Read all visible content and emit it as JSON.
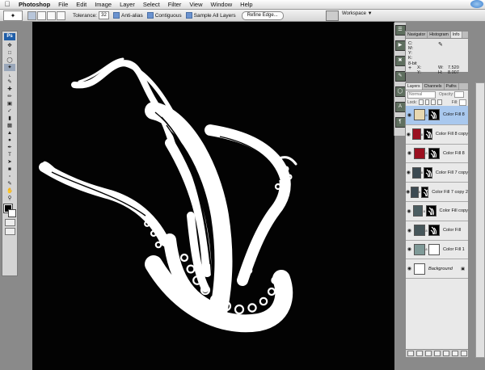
{
  "menu": {
    "app": "Photoshop",
    "items": [
      "File",
      "Edit",
      "Image",
      "Layer",
      "Select",
      "Filter",
      "View",
      "Window",
      "Help"
    ]
  },
  "options": {
    "tolerance_label": "Tolerance:",
    "tolerance_value": "32",
    "anti_alias": "Anti-alias",
    "contiguous": "Contiguous",
    "sample_all": "Sample All Layers",
    "refine": "Refine Edge...",
    "workspace": "Workspace"
  },
  "toolbox": {
    "logo": "Ps"
  },
  "navigator": {
    "tabs": [
      "Navigator",
      "Histogram",
      "Info"
    ],
    "c_label": "C:",
    "m_label": "M:",
    "y_label": "Y:",
    "k_label": "K:",
    "bit_label": "8-bit",
    "x_label": "X:",
    "x_value": "7.520",
    "y2_label": "Y:",
    "y2_value": "8.007",
    "w_label": "W:",
    "h_label": "H:"
  },
  "layers": {
    "tabs": [
      "Layers",
      "Channels",
      "Paths"
    ],
    "blend_mode": "Normal",
    "opacity_label": "Opacity:",
    "lock_label": "Lock:",
    "fill_label": "Fill:",
    "rows": [
      {
        "name": "Color Fill 8",
        "color": "#e8d8b0",
        "active": true,
        "mask": "octopus"
      },
      {
        "name": "Color Fill 8 copy",
        "color": "#9b1020",
        "active": false,
        "mask": "octopus"
      },
      {
        "name": "Color Fill 8",
        "color": "#9b1020",
        "active": false,
        "mask": "octopus"
      },
      {
        "name": "Color Fill 7 copy",
        "color": "#3c4a52",
        "active": false,
        "mask": "octopus"
      },
      {
        "name": "Color Fill 7 copy 2",
        "color": "#3c4a52",
        "active": false,
        "mask": "octopus"
      },
      {
        "name": "Color Fill copy",
        "color": "#4c5e62",
        "active": false,
        "mask": "octopus"
      },
      {
        "name": "Color Fill",
        "color": "#46565a",
        "active": false,
        "mask": "octopus"
      },
      {
        "name": "Color Fill 1",
        "color": "#7f9a98",
        "active": false,
        "mask": "white"
      },
      {
        "name": "Background",
        "color": "#ffffff",
        "active": false,
        "mask": "none"
      }
    ]
  },
  "colors": {
    "foreground": "#000000",
    "background": "#ffffff",
    "canvas": "#030303",
    "ink": "#ffffff"
  }
}
